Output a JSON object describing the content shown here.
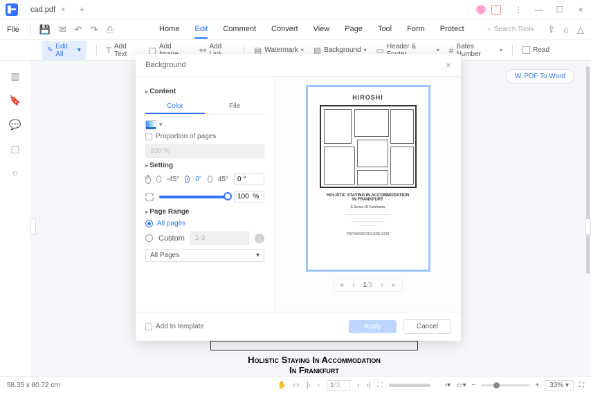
{
  "titlebar": {
    "filename": "cad.pdf"
  },
  "menus": {
    "file": "File",
    "tabs": [
      "Home",
      "Edit",
      "Comment",
      "Convert",
      "View",
      "Page",
      "Tool",
      "Form",
      "Protect"
    ],
    "active": "Edit",
    "search_placeholder": "Search Tools"
  },
  "ribbon": {
    "edit_all": "Edit All",
    "add_text": "Add Text",
    "add_image": "Add Image",
    "add_link": "Add Link",
    "watermark": "Watermark",
    "background": "Background",
    "header_footer": "Header & Footer",
    "bates": "Bates Number",
    "read": "Read"
  },
  "pdfword_btn": "PDF To Word",
  "dialog": {
    "title": "Background",
    "content_section": "Content",
    "color_tab": "Color",
    "file_tab": "File",
    "proportion_label": "Proportion of pages",
    "proportion_value": "100  %",
    "setting_section": "Setting",
    "rot": {
      "neg45": "-45°",
      "zero": "0°",
      "pos45": "45°",
      "input": "0 °"
    },
    "scale_value": "100  %",
    "page_range_section": "Page Range",
    "all_pages": "All pages",
    "custom": "Custom",
    "custom_hint": "1-3",
    "pages_select": "All Pages",
    "add_template": "Add to template",
    "apply": "Apply",
    "cancel": "Cancel",
    "preview": {
      "title": "HIROSHI",
      "caption1": "Holistic Staying In Accommodation",
      "caption2": "In Frankfurt",
      "sub": "A Sense Of Freshness",
      "url": "PDFWONDERGUIDE.COM",
      "page": "1",
      "total": "/3"
    }
  },
  "document": {
    "line1": "Holistic Staying In Accommodation",
    "line2": "In Frankfurt"
  },
  "status": {
    "dims": "58.35 x 80.72 cm",
    "page": "1",
    "pagetotal": "/3",
    "zoom": "33%"
  }
}
